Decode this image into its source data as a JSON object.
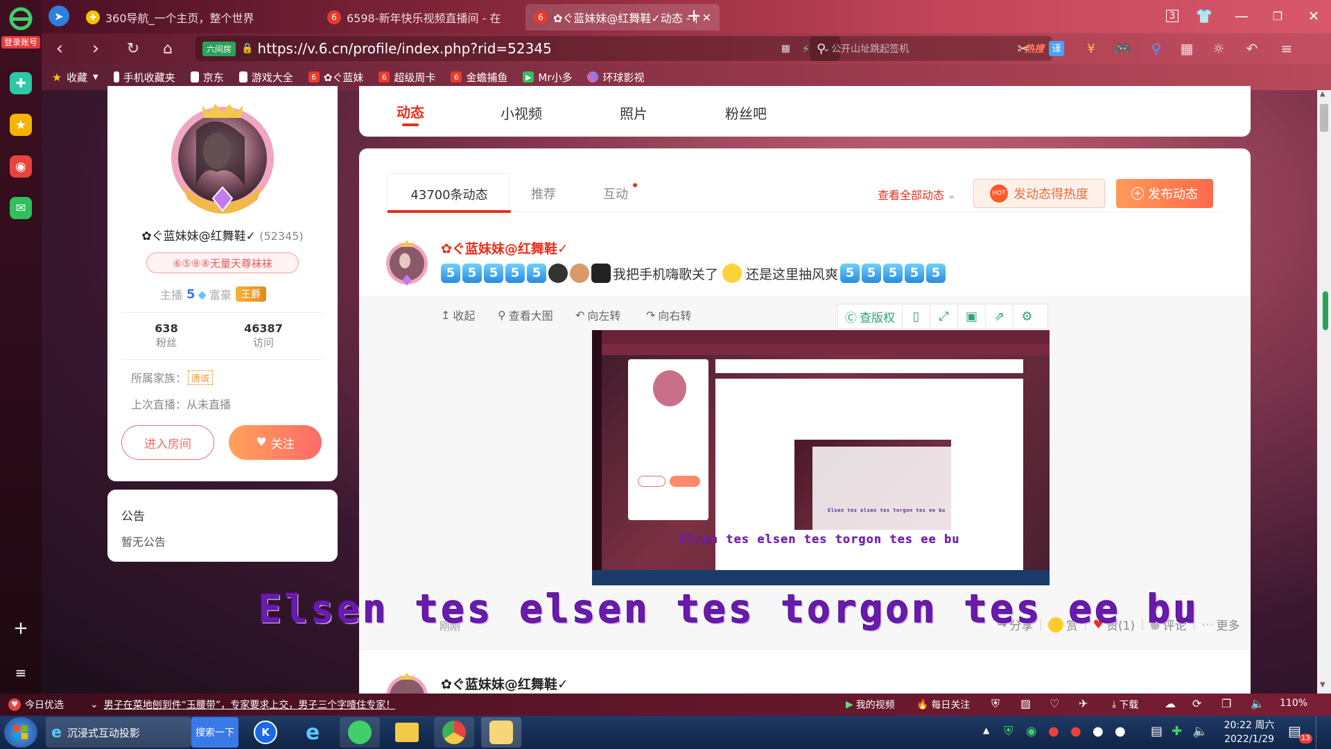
{
  "browser": {
    "login_label": "登录账号",
    "tabs": [
      {
        "label": "360导航_一个主页，整个世界",
        "active": false
      },
      {
        "label": "6598-新年快乐视频直播间 - 在",
        "active": false
      },
      {
        "label": "✿ぐ蓝妹妹@红舞鞋✓动态 - 在",
        "active": true
      }
    ],
    "tab_count": "3",
    "url_badge": "六间房",
    "url": "https://v.6.cn/profile/index.php?rid=52345",
    "search_placeholder": "公开山址跳起签机",
    "hot_label": "热搜",
    "zoom": "110%"
  },
  "bookmarks": [
    {
      "label": "收藏",
      "icon": "star-icon"
    },
    {
      "label": "手机收藏夹",
      "icon": "phone-icon"
    },
    {
      "label": "京东",
      "icon": "doc-icon"
    },
    {
      "label": "游戏大全",
      "icon": "doc-icon"
    },
    {
      "label": "✿ぐ蓝妹",
      "icon": "six-icon"
    },
    {
      "label": "超级周卡",
      "icon": "six-icon"
    },
    {
      "label": "金蟾捕鱼",
      "icon": "six-icon"
    },
    {
      "label": "Mr小多",
      "icon": "mr-icon"
    },
    {
      "label": "环球影视",
      "icon": "globe-icon"
    }
  ],
  "profile": {
    "name": "✿ぐ蓝妹妹@红舞鞋✓",
    "rid": "(52345)",
    "title_badge": "⑥⑤⑨⑧无量天尊袜袜",
    "anchor_label": "主播",
    "anchor_level": "5",
    "rich_label": "富豪",
    "rich_badge": "王爵",
    "fans_count": "638",
    "fans_label": "粉丝",
    "visits_count": "46387",
    "visits_label": "访问",
    "family_label": "所属家族：",
    "family_badge": "唐诚",
    "last_live": "上次直播：从未直播",
    "enter_room": "进入房间",
    "follow": "关注"
  },
  "notice": {
    "title": "公告",
    "content": "暂无公告"
  },
  "nav_tabs": [
    "动态",
    "小视频",
    "照片",
    "粉丝吧"
  ],
  "feed": {
    "sub_tabs": [
      "43700条动态",
      "推荐",
      "互动"
    ],
    "view_all": "查看全部动态",
    "hot_button": "发动态得热度",
    "publish_button": "发布动态",
    "post": {
      "author": "✿ぐ蓝妹妹@红舞鞋✓",
      "text_a": "我把手机嗨歌关了",
      "text_b": "还是这里抽风爽",
      "emoji_level": "5",
      "time": "刚刚",
      "image_tools": [
        "收起",
        "查看大图",
        "向左转",
        "向右转"
      ],
      "copyright_label": "查版权",
      "actions": {
        "share": "分享",
        "reward": "赏",
        "like": "赞(1)",
        "comment": "评论",
        "more": "更多"
      }
    },
    "next_post_author": "✿ぐ蓝妹妹@红舞鞋✓"
  },
  "overlay": {
    "big_text": "Elsen tes elsen tes torgon tes ee bu",
    "inner_text": "Elsen tes elsen tes torgon tes ee bu",
    "inner2_text": "Elsen tes elsen tes torgon tes ee bu"
  },
  "statusbar": {
    "today": "今日优选",
    "news": "男子在菜地刨到件“玉腰带”，专家要求上交，男子三个字噎住专家！",
    "my_video": "我的视频",
    "daily": "每日关注",
    "download": "下载",
    "zoom": "110%"
  },
  "taskbar": {
    "ie_label": "沉浸式互动投影",
    "search_btn": "搜索一下",
    "time": "20:22 周六",
    "date": "2022/1/29",
    "notif_count": "13"
  },
  "colors": {
    "brand": "#ff4b3a",
    "accent": "#f06a6a",
    "active_tab": "#e8301c"
  }
}
